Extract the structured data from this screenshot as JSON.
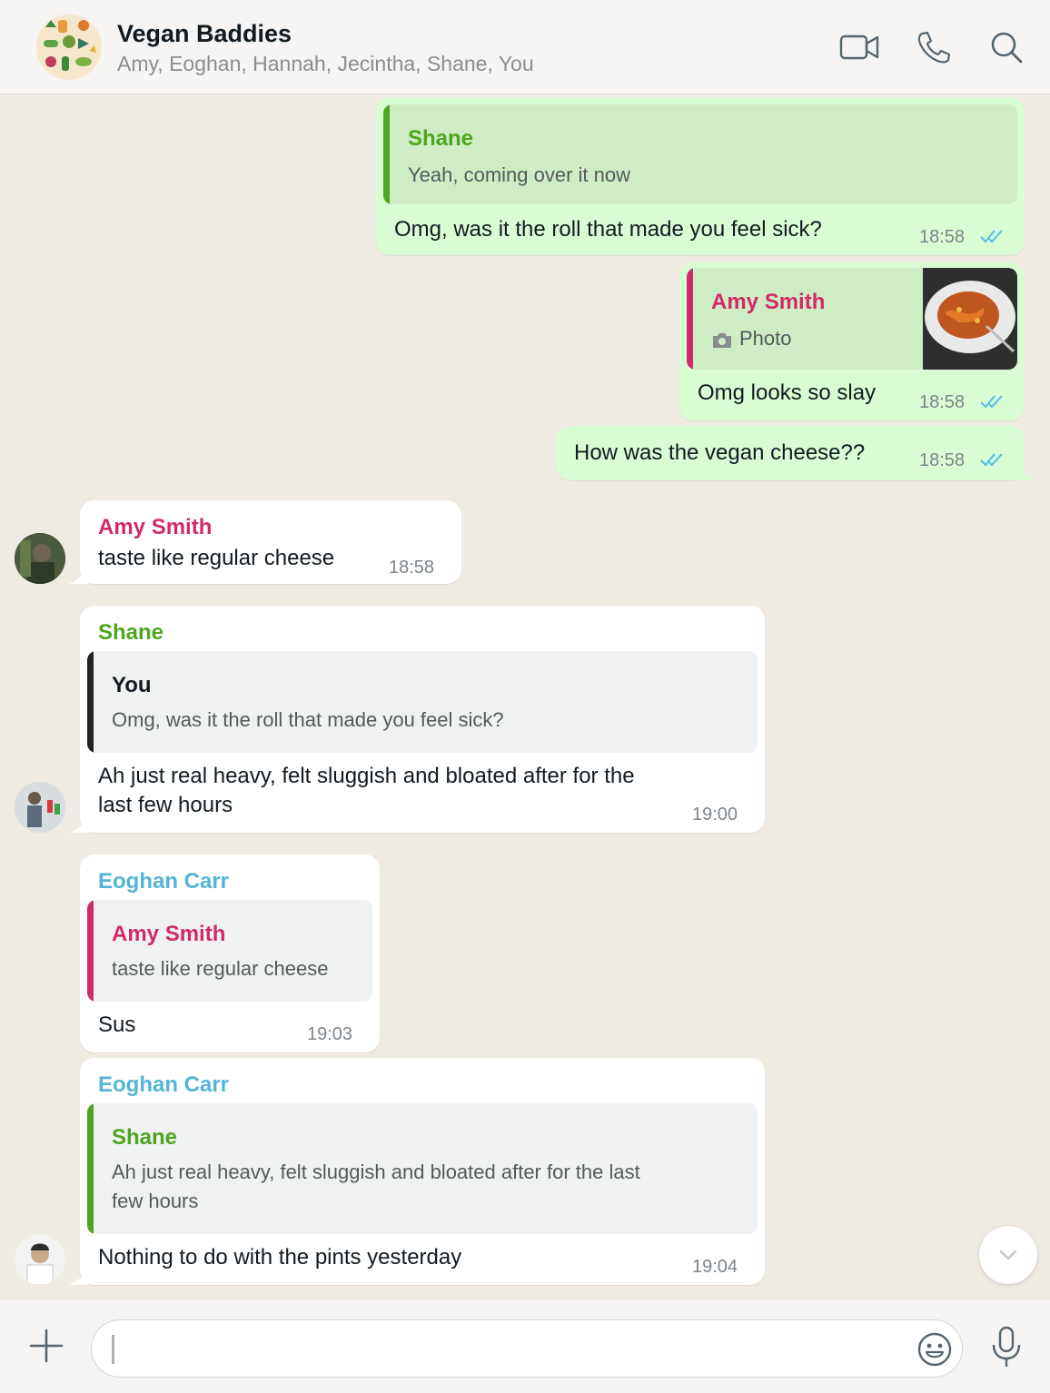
{
  "header": {
    "title": "Vegan Baddies",
    "members": "Amy, Eoghan, Hannah, Jecintha, Shane, You"
  },
  "colors": {
    "shane": "#4ea61f",
    "amy": "#d02a6b",
    "eoghan": "#53b5d6",
    "you": "#111b21",
    "outgoing_bubble": "#d9fdd3",
    "tick_blue": "#53bdeb"
  },
  "messages": {
    "m1": {
      "quote_name": "Shane",
      "quote_text": "Yeah, coming over it now",
      "text": "Omg, was it the roll that made you feel sick?",
      "time": "18:58"
    },
    "m2": {
      "quote_name": "Amy Smith",
      "quote_text": "Photo",
      "quote_icon": "camera-icon",
      "text": "Omg looks so slay",
      "time": "18:58"
    },
    "m3": {
      "text": "How was the vegan cheese??",
      "time": "18:58"
    },
    "m4": {
      "sender": "Amy Smith",
      "text": "taste like regular cheese",
      "time": "18:58"
    },
    "m5": {
      "sender": "Shane",
      "quote_name": "You",
      "quote_text": "Omg, was it the roll that made you feel sick?",
      "text_line1": "Ah just real heavy, felt sluggish and bloated after for the",
      "text_line2": "last few hours",
      "time": "19:00"
    },
    "m6": {
      "sender": "Eoghan Carr",
      "quote_name": "Amy Smith",
      "quote_text": "taste like regular cheese",
      "text": "Sus",
      "time": "19:03"
    },
    "m7": {
      "sender": "Eoghan Carr",
      "quote_name": "Shane",
      "quote_text_line1": "Ah just real heavy, felt sluggish and bloated after for the last",
      "quote_text_line2": "few hours",
      "text": "Nothing to do with the pints yesterday",
      "time": "19:04"
    }
  },
  "composer": {
    "value": ""
  }
}
